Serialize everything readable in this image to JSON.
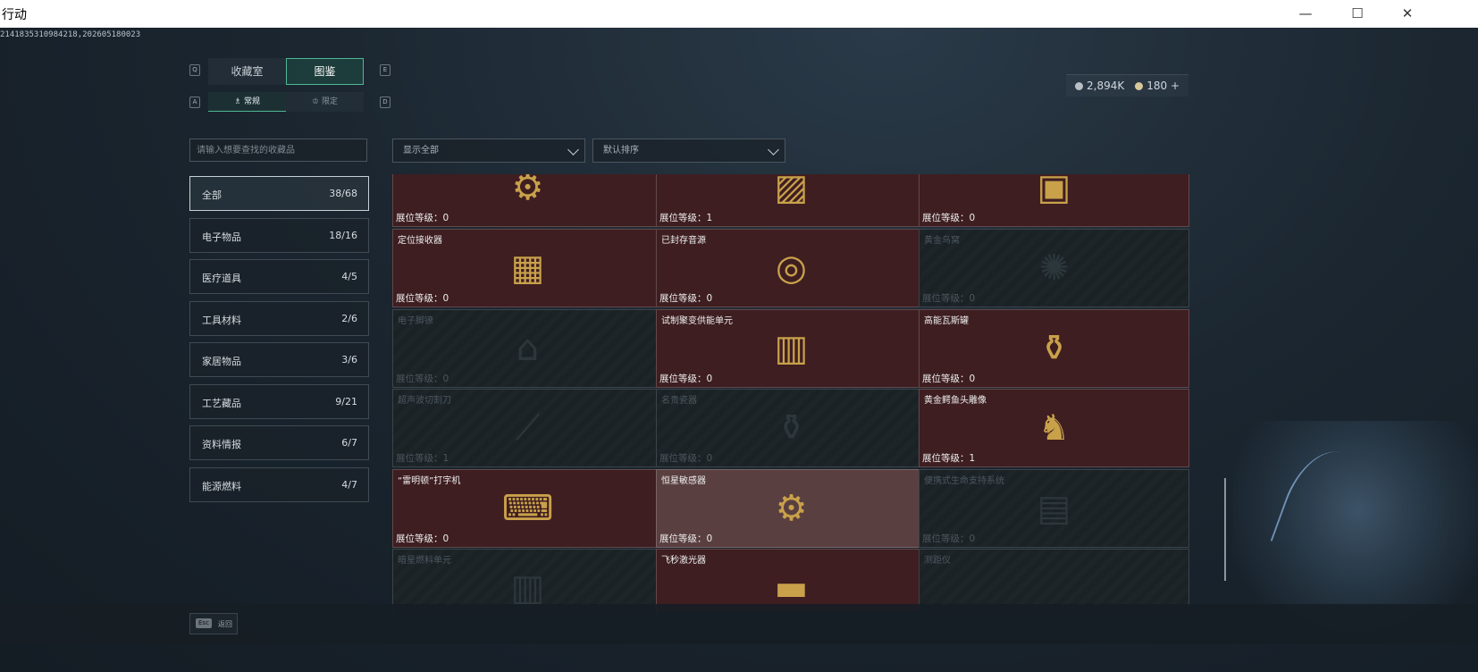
{
  "window": {
    "title": "行动",
    "minimize": "—",
    "maximize": "☐",
    "close": "✕"
  },
  "build_id": "2141835310984218,202605180023",
  "currency": [
    {
      "amount": "2,894K",
      "color": "#b8bfc5"
    },
    {
      "amount": "180",
      "color": "#d8c79a",
      "plus": "+"
    }
  ],
  "main_tabs": {
    "key_left": "Q",
    "key_right": "E",
    "items": [
      {
        "label": "收藏室",
        "active": false
      },
      {
        "label": "图鉴",
        "active": true
      }
    ]
  },
  "sub_tabs": {
    "key_left": "A",
    "key_right": "D",
    "items": [
      {
        "label": "常规",
        "icon": "bottle-icon",
        "active": true
      },
      {
        "label": "限定",
        "icon": "crown-icon",
        "active": false
      }
    ]
  },
  "search": {
    "placeholder": "请输入想要查找的收藏品"
  },
  "filters": {
    "show": "显示全部",
    "sort": "默认排序"
  },
  "categories": [
    {
      "name": "全部",
      "count": "38/68",
      "active": true
    },
    {
      "name": "电子物品",
      "count": "18/16"
    },
    {
      "name": "医疗道具",
      "count": "4/5"
    },
    {
      "name": "工具材料",
      "count": "2/6"
    },
    {
      "name": "家居物品",
      "count": "3/6"
    },
    {
      "name": "工艺藏品",
      "count": "9/21"
    },
    {
      "name": "资料情报",
      "count": "6/7"
    },
    {
      "name": "能源燃料",
      "count": "4/7"
    }
  ],
  "items": [
    {
      "name": "",
      "level": "展位等级：0",
      "state": "owned",
      "icon": "⚙"
    },
    {
      "name": "",
      "level": "展位等级：1",
      "state": "owned",
      "icon": "▨"
    },
    {
      "name": "",
      "level": "展位等级：0",
      "state": "owned",
      "icon": "▣"
    },
    {
      "name": "定位接收器",
      "level": "展位等级：0",
      "state": "owned",
      "icon": "▦"
    },
    {
      "name": "已封存音源",
      "level": "展位等级：0",
      "state": "owned",
      "icon": "◎"
    },
    {
      "name": "黄金鸟窝",
      "level": "展位等级：0",
      "state": "locked",
      "icon": "✺"
    },
    {
      "name": "电子脚镣",
      "level": "展位等级：0",
      "state": "locked",
      "icon": "⌂"
    },
    {
      "name": "试制聚变供能单元",
      "level": "展位等级：0",
      "state": "owned",
      "icon": "▥"
    },
    {
      "name": "高能瓦斯罐",
      "level": "展位等级：0",
      "state": "owned",
      "icon": "⚱"
    },
    {
      "name": "超声波切割刀",
      "level": "展位等级：1",
      "state": "locked",
      "icon": "⟋"
    },
    {
      "name": "名贵瓷器",
      "level": "展位等级：0",
      "state": "locked",
      "icon": "⚱"
    },
    {
      "name": "黄金鳄鱼头雕像",
      "level": "展位等级：1",
      "state": "owned",
      "icon": "♞"
    },
    {
      "name": "“雷明顿”打字机",
      "level": "展位等级：0",
      "state": "owned",
      "icon": "⌨"
    },
    {
      "name": "恒星敏感器",
      "level": "展位等级：0",
      "state": "owned",
      "highlight": true,
      "icon": "⚙"
    },
    {
      "name": "便携式生命支持系统",
      "level": "展位等级：0",
      "state": "locked",
      "icon": "▤"
    },
    {
      "name": "暗星燃料单元",
      "level": "",
      "state": "locked",
      "icon": "▥"
    },
    {
      "name": "飞秒激光器",
      "level": "",
      "state": "owned",
      "icon": "▬"
    },
    {
      "name": "测距仪",
      "level": "",
      "state": "locked",
      "icon": ""
    }
  ],
  "footer": {
    "key": "Esc",
    "label": "返回"
  }
}
